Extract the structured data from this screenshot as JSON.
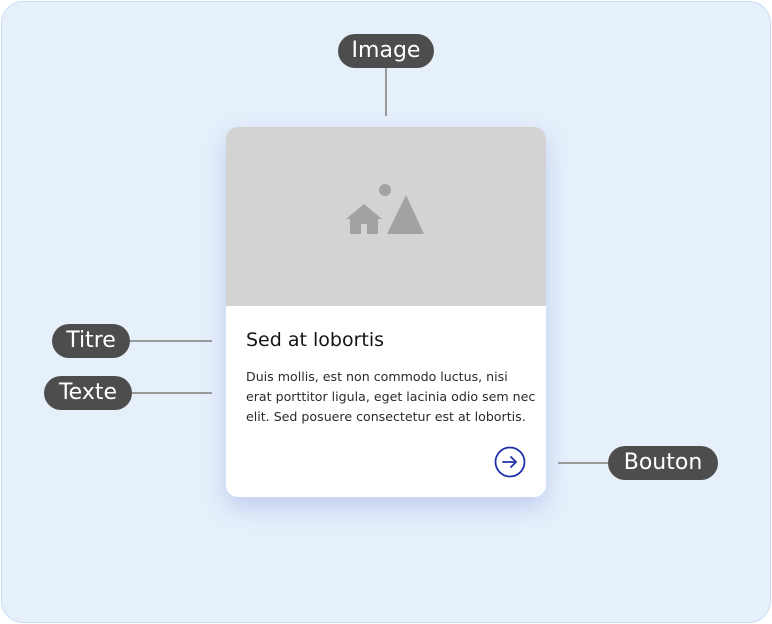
{
  "callouts": {
    "image": "Image",
    "title": "Titre",
    "text": "Texte",
    "button": "Bouton"
  },
  "card": {
    "title": "Sed at lobortis",
    "body": "Duis mollis, est non commodo luctus, nisi erat porttitor ligula, eget lacinia odio sem nec elit. Sed posuere consectetur est at lobortis.",
    "image_icon": "image-placeholder-icon",
    "button_icon": "arrow-right-circle-icon"
  },
  "colors": {
    "panel_background": "#e6f0fb",
    "callout_background": "#4d4d4d",
    "image_placeholder": "#d3d3d3",
    "button_accent": "#1f2fa8"
  }
}
